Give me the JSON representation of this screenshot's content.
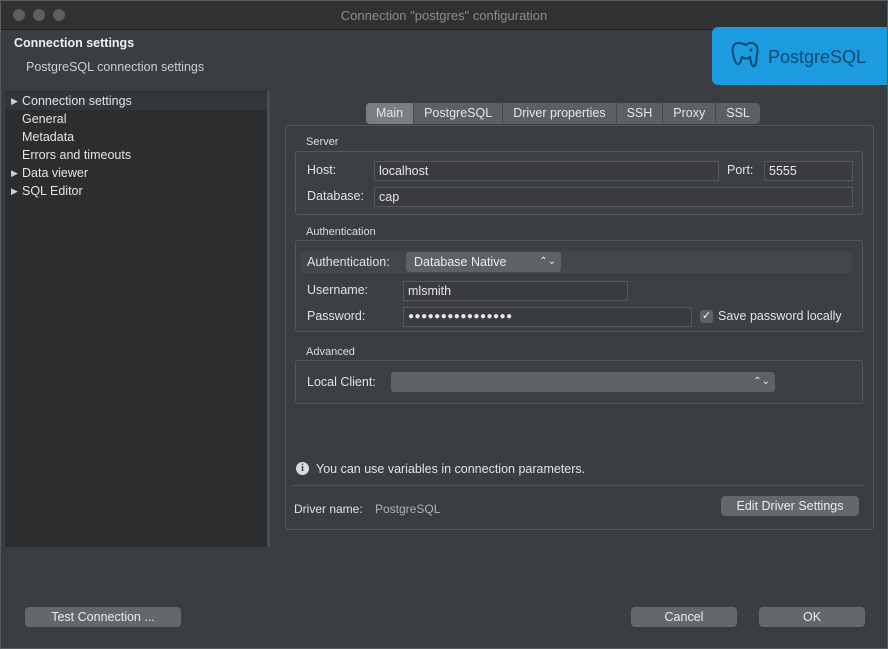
{
  "window": {
    "title": "Connection \"postgres\" configuration"
  },
  "header": {
    "title": "Connection settings",
    "subtitle": "PostgreSQL connection settings",
    "logo_text": "PostgreSQL"
  },
  "sidebar": {
    "items": [
      {
        "label": "Connection settings",
        "expandable": true,
        "selected": true
      },
      {
        "label": "General",
        "expandable": false
      },
      {
        "label": "Metadata",
        "expandable": false
      },
      {
        "label": "Errors and timeouts",
        "expandable": false
      },
      {
        "label": "Data viewer",
        "expandable": true
      },
      {
        "label": "SQL Editor",
        "expandable": true
      }
    ]
  },
  "tabs": [
    {
      "label": "Main",
      "active": true
    },
    {
      "label": "PostgreSQL"
    },
    {
      "label": "Driver properties"
    },
    {
      "label": "SSH"
    },
    {
      "label": "Proxy"
    },
    {
      "label": "SSL"
    }
  ],
  "server": {
    "group_label": "Server",
    "host_label": "Host:",
    "host_value": "localhost",
    "port_label": "Port:",
    "port_value": "5555",
    "database_label": "Database:",
    "database_value": "cap"
  },
  "auth": {
    "group_label": "Authentication",
    "auth_label": "Authentication:",
    "auth_value": "Database Native",
    "username_label": "Username:",
    "username_value": "mlsmith",
    "password_label": "Password:",
    "password_value": "●●●●●●●●●●●●●●●●",
    "save_password_label": "Save password locally",
    "save_password_checked": true
  },
  "advanced": {
    "group_label": "Advanced",
    "local_client_label": "Local Client:",
    "local_client_value": ""
  },
  "info": {
    "text": "You can use variables in connection parameters."
  },
  "driver": {
    "label": "Driver name:",
    "value": "PostgreSQL",
    "edit_button": "Edit Driver Settings"
  },
  "footer": {
    "test_button": "Test Connection ...",
    "cancel_button": "Cancel",
    "ok_button": "OK"
  },
  "colors": {
    "accent": "#1c9be1",
    "background": "#3b3e41",
    "sidebar": "#2b2d2f"
  }
}
